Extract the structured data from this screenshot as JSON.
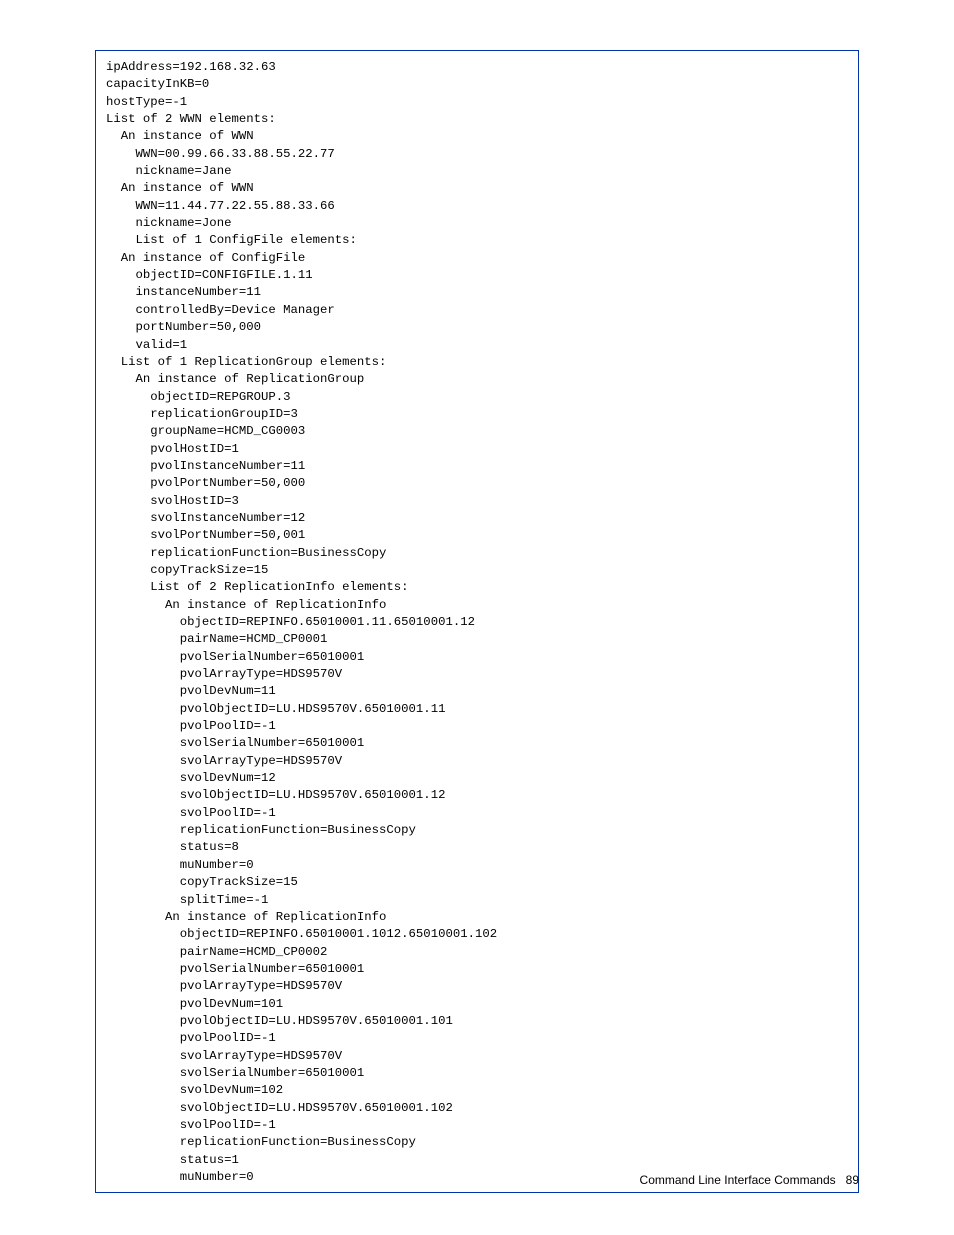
{
  "code": {
    "lines": [
      "ipAddress=192.168.32.63",
      "capacityInKB=0",
      "hostType=-1",
      "List of 2 WWN elements:",
      "  An instance of WWN",
      "    WWN=00.99.66.33.88.55.22.77",
      "    nickname=Jane",
      "  An instance of WWN",
      "    WWN=11.44.77.22.55.88.33.66",
      "    nickname=Jone",
      "    List of 1 ConfigFile elements:",
      "  An instance of ConfigFile",
      "    objectID=CONFIGFILE.1.11",
      "    instanceNumber=11",
      "    controlledBy=Device Manager",
      "    portNumber=50,000",
      "    valid=1",
      "  List of 1 ReplicationGroup elements:",
      "    An instance of ReplicationGroup",
      "      objectID=REPGROUP.3",
      "      replicationGroupID=3",
      "      groupName=HCMD_CG0003",
      "      pvolHostID=1",
      "      pvolInstanceNumber=11",
      "      pvolPortNumber=50,000",
      "      svolHostID=3",
      "      svolInstanceNumber=12",
      "      svolPortNumber=50,001",
      "      replicationFunction=BusinessCopy",
      "      copyTrackSize=15",
      "      List of 2 ReplicationInfo elements:",
      "        An instance of ReplicationInfo",
      "          objectID=REPINFO.65010001.11.65010001.12",
      "          pairName=HCMD_CP0001",
      "          pvolSerialNumber=65010001",
      "          pvolArrayType=HDS9570V",
      "          pvolDevNum=11",
      "          pvolObjectID=LU.HDS9570V.65010001.11",
      "          pvolPoolID=-1",
      "          svolSerialNumber=65010001",
      "          svolArrayType=HDS9570V",
      "          svolDevNum=12",
      "          svolObjectID=LU.HDS9570V.65010001.12",
      "          svolPoolID=-1",
      "          replicationFunction=BusinessCopy",
      "          status=8",
      "          muNumber=0",
      "          copyTrackSize=15",
      "          splitTime=-1",
      "        An instance of ReplicationInfo",
      "          objectID=REPINFO.65010001.1012.65010001.102",
      "          pairName=HCMD_CP0002",
      "          pvolSerialNumber=65010001",
      "          pvolArrayType=HDS9570V",
      "          pvolDevNum=101",
      "          pvolObjectID=LU.HDS9570V.65010001.101",
      "          pvolPoolID=-1",
      "          svolArrayType=HDS9570V",
      "          svolSerialNumber=65010001",
      "          svolDevNum=102",
      "          svolObjectID=LU.HDS9570V.65010001.102",
      "          svolPoolID=-1",
      "          replicationFunction=BusinessCopy",
      "          status=1",
      "          muNumber=0"
    ]
  },
  "footer": {
    "section": "Command Line Interface Commands",
    "page_number": "89"
  }
}
